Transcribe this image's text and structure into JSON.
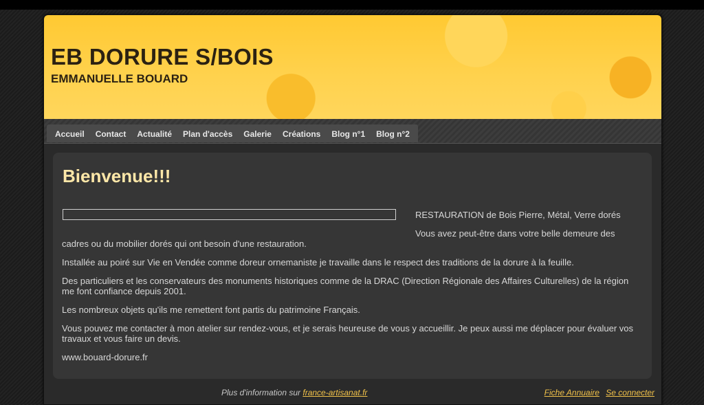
{
  "header": {
    "title": "EB DORURE S/BOIS",
    "subtitle": "EMMANUELLE BOUARD"
  },
  "nav": {
    "items": [
      "Accueil",
      "Contact",
      "Actualité",
      "Plan d'accès",
      "Galerie",
      "Créations",
      "Blog n°1",
      "Blog n°2"
    ]
  },
  "main": {
    "heading": "Bienvenue!!!",
    "line1": "RESTAURATION de Bois Pierre, Métal, Verre dorés",
    "line2a": "Vous avez peut-être dans votre belle demeure des",
    "line2b": "cadres ou du mobilier dorés qui ont besoin d'une restauration.",
    "p3": " Installée au poiré sur Vie en Vendée comme doreur ornemaniste je travaille dans le respect des traditions de la dorure à la feuille.",
    "p4a": " Des particuliers et les conservateurs des monuments historiques comme de la DRAC (Direction Régionale des Affaires Culturelles) de la région",
    "p4b": "me font confiance depuis 2001.",
    "p5": "Les nombreux objets  qu'ils me remettent font partis du patrimoine Français.",
    "p6a": " Vous pouvez me contacter à mon atelier sur rendez-vous, et je serais heureuse de vous y accueillir. Je peux aussi me déplacer pour évaluer vos",
    "p6b": "travaux et vous faire un devis.",
    "p7": "www.bouard-dorure.fr"
  },
  "footer": {
    "info_prefix": "Plus d'information sur",
    "info_link": "france-artisanat.fr",
    "annuaire": "Fiche Annuaire",
    "login": "Se connecter"
  },
  "colors": {
    "header_bg": "#fcc83a",
    "heading": "#fde7a8",
    "link": "#f2c24a"
  }
}
